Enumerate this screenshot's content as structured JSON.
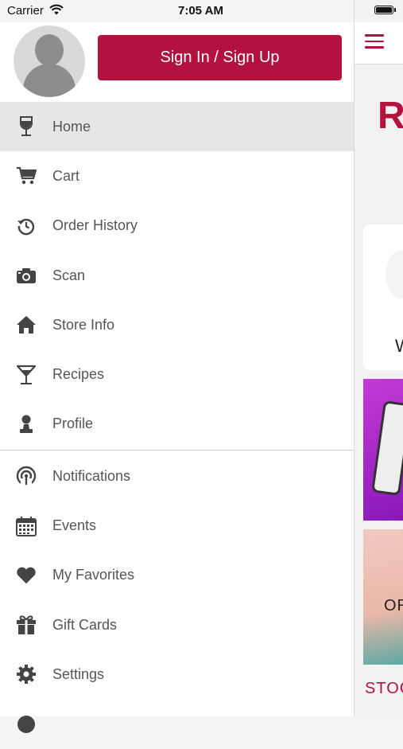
{
  "status_bar": {
    "carrier": "Carrier",
    "time": "7:05 AM"
  },
  "drawer": {
    "sign_in_label": "Sign In / Sign Up",
    "menu_primary": [
      {
        "label": "Home",
        "icon": "wine-glass-icon",
        "active": true
      },
      {
        "label": "Cart",
        "icon": "cart-icon"
      },
      {
        "label": "Order History",
        "icon": "history-icon"
      },
      {
        "label": "Scan",
        "icon": "camera-icon"
      },
      {
        "label": "Store Info",
        "icon": "home-icon"
      },
      {
        "label": "Recipes",
        "icon": "cocktail-icon"
      },
      {
        "label": "Profile",
        "icon": "person-icon"
      }
    ],
    "menu_secondary": [
      {
        "label": "Notifications",
        "icon": "broadcast-icon"
      },
      {
        "label": "Events",
        "icon": "calendar-icon"
      },
      {
        "label": "My Favorites",
        "icon": "heart-icon"
      },
      {
        "label": "Gift Cards",
        "icon": "gift-icon"
      },
      {
        "label": "Settings",
        "icon": "gear-icon"
      }
    ]
  },
  "background_app": {
    "logo_letter": "R",
    "card_letter": "W",
    "promo_text": "OR",
    "stock_text": "STOC"
  },
  "colors": {
    "accent": "#b3123f",
    "active_row": "#e6e6e6",
    "icon": "#444444"
  }
}
